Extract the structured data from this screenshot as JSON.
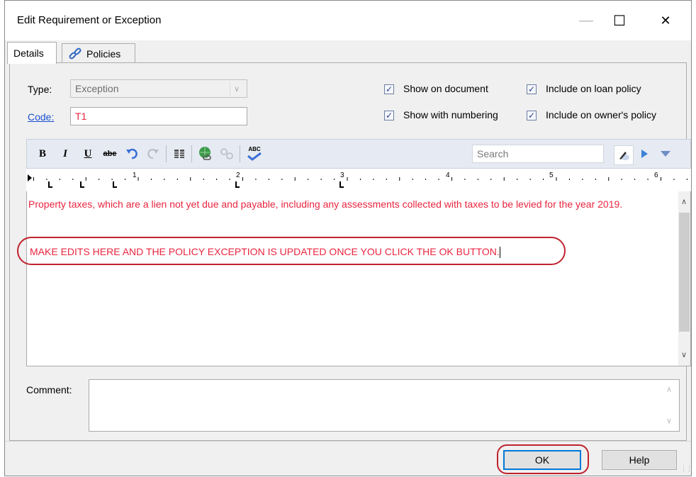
{
  "window": {
    "title": "Edit Requirement or Exception",
    "minimize": "—",
    "maximize": "☐",
    "close": "✕"
  },
  "tabs": [
    {
      "label": "Details"
    },
    {
      "label": "Policies"
    }
  ],
  "form": {
    "type_label": "Type:",
    "type_value": "Exception",
    "code_label": "Code:",
    "code_value": "T1",
    "checkboxes": [
      {
        "label": "Show on document",
        "checked": true
      },
      {
        "label": "Include on loan policy",
        "checked": true
      },
      {
        "label": "Show with numbering",
        "checked": true
      },
      {
        "label": "Include on owner's policy",
        "checked": true
      }
    ]
  },
  "toolbar": {
    "bold": "B",
    "italic": "I",
    "underline": "U",
    "strike": "abe",
    "spell": "ABC",
    "search_placeholder": "Search"
  },
  "ruler": {
    "numbers": [
      "1",
      "2",
      "3",
      "4",
      "5",
      "6"
    ]
  },
  "editor": {
    "paragraph1": "Property taxes, which are a lien not yet due and payable, including any assessments collected with taxes to be levied for the year 2019.",
    "paragraph2": "MAKE EDITS HERE AND THE POLICY EXCEPTION IS UPDATED ONCE YOU CLICK THE OK BUTTON."
  },
  "comment": {
    "label": "Comment:",
    "value": ""
  },
  "buttons": {
    "ok": "OK",
    "help": "Help"
  },
  "colors": {
    "highlight": "#c0222d",
    "text_red": "#e8253f",
    "link": "#1a4fd0"
  }
}
